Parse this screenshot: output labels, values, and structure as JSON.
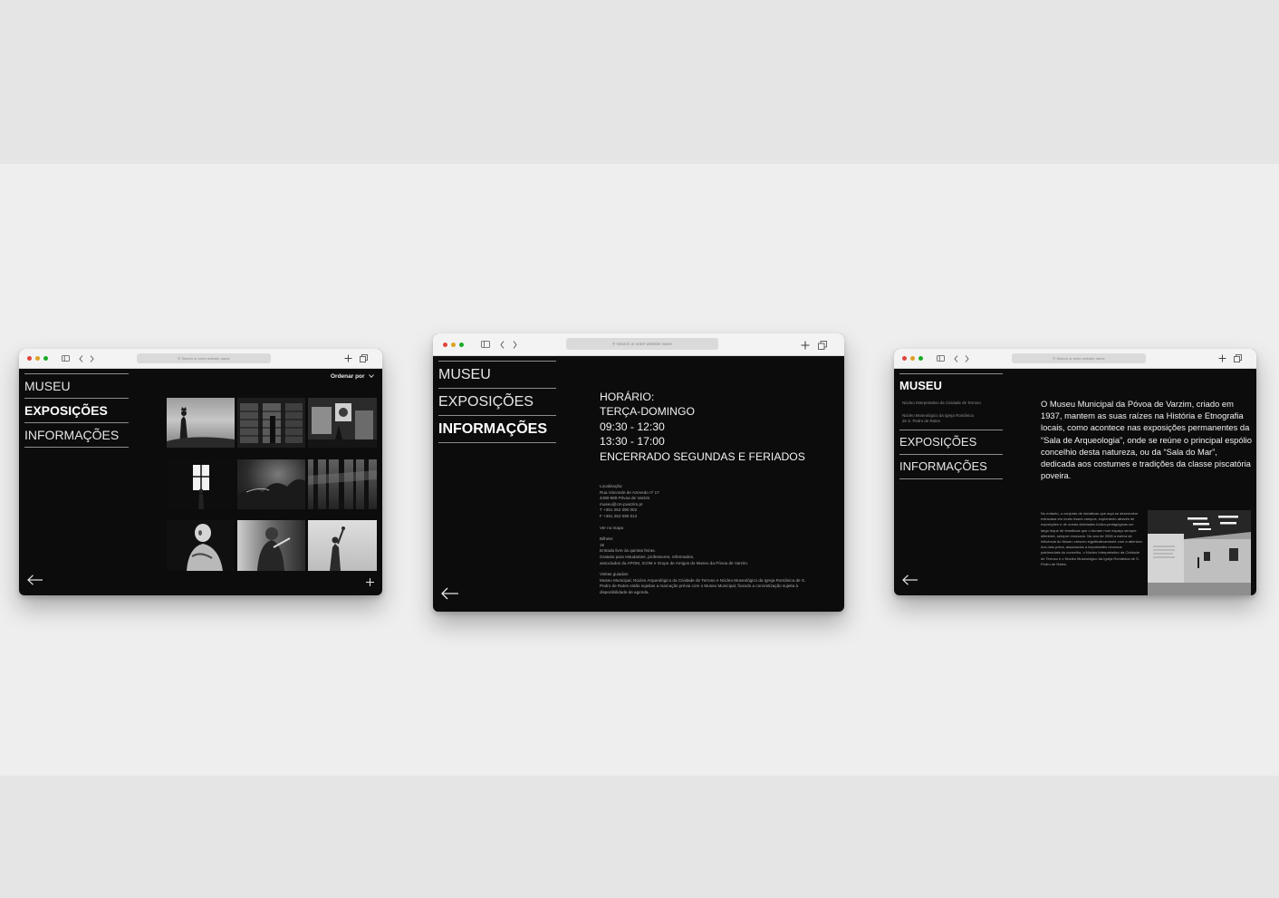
{
  "browser": {
    "search_placeholder": "Search or enter website name",
    "traffic_lights": [
      "#e0443e",
      "#dea123",
      "#1aab29"
    ]
  },
  "nav": {
    "museu": "MUSEU",
    "exposicoes": "EXPOSIÇÕES",
    "informacoes": "INFORMAÇÕES"
  },
  "exhibitions": {
    "sort_label": "Ordenar por",
    "chevron_icon": "chevron-down-icon",
    "plus_icon": "plus-icon",
    "back_icon": "arrow-left-icon"
  },
  "info": {
    "schedule": [
      "HORÁRIO:",
      "TERÇA-DOMINGO",
      "09:30 - 12:30",
      "13:30 - 17:00",
      "ENCERRADO SEGUNDAS E FERIADOS"
    ],
    "location_title": "Localização:",
    "location_lines": [
      "Rua Visconde de Azevedo nº 17",
      "4490-589 Póvoa de Varzim",
      "museu@cm-pvarzim.pt",
      "T +351 252 090 002",
      "F +351 252 090 012"
    ],
    "map_link": "Ver no mapa",
    "ticket_title": "Bilhete:",
    "ticket_lines": [
      "1€",
      "Entrada livre às quintas feiras.",
      "Gratuito para estudantes, professores, reformados,",
      "associados da APOM, ICOM e Grupo de Amigos do Museu da Póvoa de Varzim."
    ],
    "visits_title": "Visitas guiadas:",
    "visits_lines": [
      "Museu Municipal, Núcleo Arqueológico da Cividade de Terroso e Núcleo Museológico da Igreja Românica de S.",
      "Pedro de Rates estão sujeitas a marcação prévia com o Museu Municipal, ficando a concretização sujeita à",
      "disponibilidade de agenda."
    ]
  },
  "museum": {
    "sub_items": [
      "Núcleo Interpretativo da Cividade de Terroso",
      "Núcleo Museológico da Igreja Românica de S. Pedro de Rates"
    ],
    "intro": "O Museu Municipal da Póvoa de Varzim, criado em 1937, mantem as suas raízes na História e Etnografia locais, como acontece nas exposições permanentes da “Sala de Arqueologia”, onde se reúne o principal espólio concelhio desta natureza, ou da “Sala do Mar”, dedicada aos costumes e tradições da classe piscatória poveira.",
    "body": "No entanto, o conjunto de iniciativas que aqui se desenvolve extravasa em muito esses campos, explorando através de exposições e de outras atividades lúdico-pedagógicas um largo leque de temáticas que o tornam num espaço sempre diferente, sempre renovado. No ano de 2008 a esfera de influência do Museu cresceu significativamente com a abertura dos dois polos, associados a importantes recursos patrimoniais do concelho, o Núcleo Interpretativo da Cividade de Terroso e o Núcleo Museológico da Igreja Românica de S. Pedro de Rates."
  }
}
